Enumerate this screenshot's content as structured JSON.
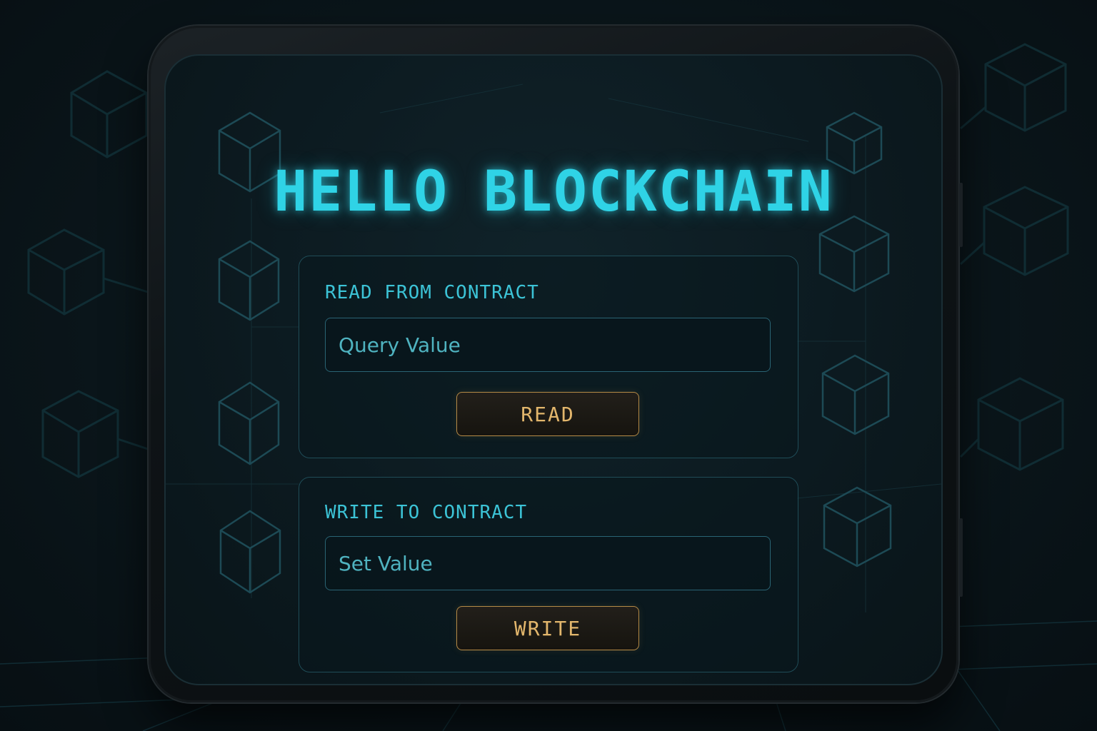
{
  "app": {
    "title": "HELLO BLOCKCHAIN"
  },
  "read_section": {
    "label": "READ FROM CONTRACT",
    "input_placeholder": "Query Value",
    "input_value": "",
    "button_label": "READ"
  },
  "write_section": {
    "label": "WRITE TO CONTRACT",
    "input_placeholder": "Set Value",
    "input_value": "",
    "button_label": "WRITE"
  },
  "theme": {
    "accent": "#2fd3e6",
    "button_text": "#e2b66c",
    "button_border": "#b58a46",
    "background": "#0a1419"
  },
  "icons": [
    "cube-icon"
  ]
}
